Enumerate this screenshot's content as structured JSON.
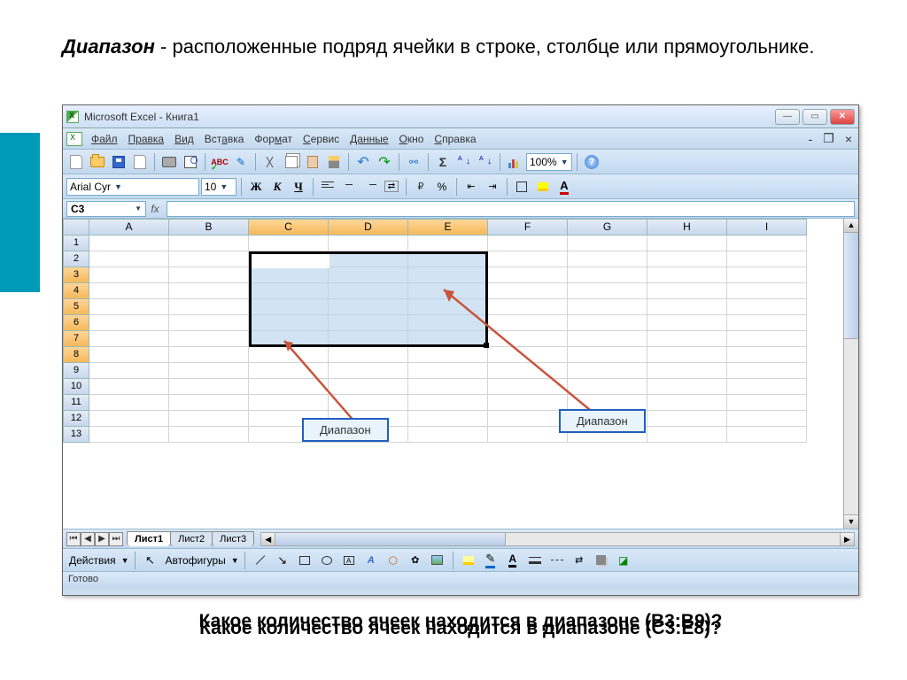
{
  "slide": {
    "title_bold": "Диапазон",
    "title_rest": " - расположенные подряд ячейки в строке, столбце или прямоугольнике."
  },
  "window": {
    "title": "Microsoft Excel - Книга1"
  },
  "menu": {
    "file": "Файл",
    "edit": "Правка",
    "view": "Вид",
    "insert": "Вставка",
    "format": "Формат",
    "tools": "Сервис",
    "data": "Данные",
    "window": "Окно",
    "help": "Справка"
  },
  "toolbar": {
    "zoom": "100%",
    "font_name": "Arial Cyr",
    "font_size": "10",
    "bold": "Ж",
    "italic": "К",
    "underline": "Ч",
    "currency": "%"
  },
  "namebox": {
    "value": "C3",
    "fx": "fx"
  },
  "columns": [
    "A",
    "B",
    "C",
    "D",
    "E",
    "F",
    "G",
    "H",
    "I"
  ],
  "rows": [
    "1",
    "2",
    "3",
    "4",
    "5",
    "6",
    "7",
    "8",
    "9",
    "10",
    "11",
    "12",
    "13"
  ],
  "selected_cols": [
    "C",
    "D",
    "E"
  ],
  "selected_rows": [
    "3",
    "4",
    "5",
    "6",
    "7",
    "8"
  ],
  "callouts": {
    "label1": "Диапазон",
    "label2": "Диапазон"
  },
  "sheets": {
    "tab1": "Лист1",
    "tab2": "Лист2",
    "tab3": "Лист3"
  },
  "draw": {
    "actions": "Действия",
    "autoshapes": "Автофигуры"
  },
  "status": {
    "ready": "Готово"
  },
  "question": {
    "layer1": "Какое количество ячеек находится в диапазоне (B3:B9)?",
    "layer2": "Какое количество ячеек находится в диапазоне (C3:E8)?"
  },
  "icons": {
    "abc": "ABC",
    "sigma": "Σ",
    "help": "?",
    "pct": "%",
    "undo": "↶",
    "redo": "↷",
    "link": "⚯",
    "font_a": "A"
  }
}
